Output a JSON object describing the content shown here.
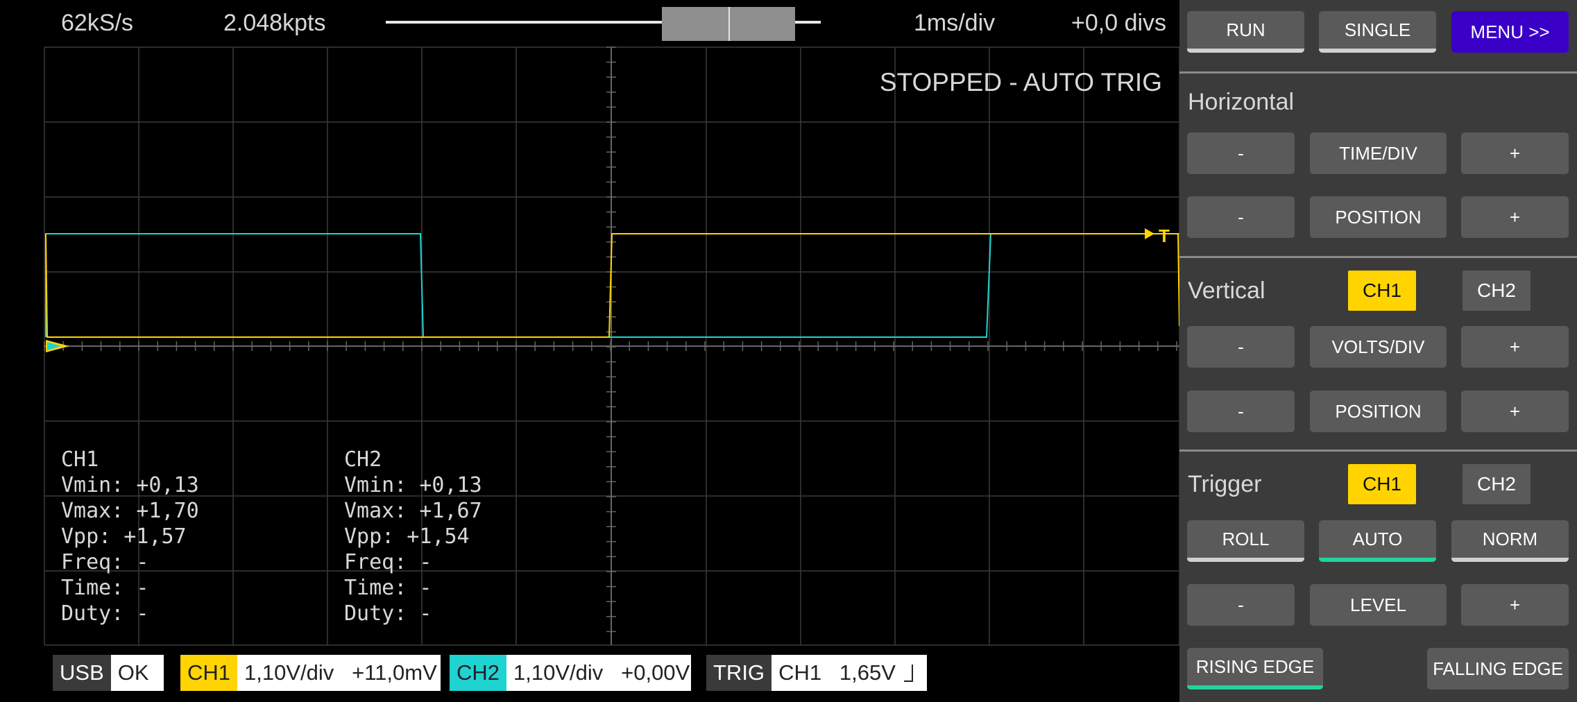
{
  "topbar": {
    "sample_rate": "62kS/s",
    "points": "2.048kpts",
    "timebase": "1ms/div",
    "offset": "+0,0 divs"
  },
  "status": "STOPPED - AUTO TRIG",
  "measurements": {
    "ch1": {
      "title": "CH1",
      "vmin": "Vmin: +0,13",
      "vmax": "Vmax: +1,70",
      "vpp": "Vpp: +1,57",
      "freq": "Freq: -",
      "time": "Time: -",
      "duty": "Duty: -"
    },
    "ch2": {
      "title": "CH2",
      "vmin": "Vmin: +0,13",
      "vmax": "Vmax: +1,67",
      "vpp": "Vpp: +1,54",
      "freq": "Freq: -",
      "time": "Time: -",
      "duty": "Duty: -"
    }
  },
  "bottom": {
    "usb_tag": "USB",
    "usb_val": "OK",
    "ch1_tag": "CH1",
    "ch1_val": "1,10V/div   +11,0mV",
    "ch2_tag": "CH2",
    "ch2_val": "1,10V/div   +0,00V",
    "trig_tag": "TRIG",
    "trig_val": "CH1   1,65V"
  },
  "colors": {
    "ch1": "#ffd400",
    "ch2": "#1fd3d3",
    "menu": "#3a00c8",
    "active": "#1fd3a0"
  },
  "panel": {
    "run": "RUN",
    "single": "SINGLE",
    "menu": "MENU >>",
    "horizontal": "Horizontal",
    "minus": "-",
    "plus": "+",
    "time_div": "TIME/DIV",
    "position": "POSITION",
    "vertical": "Vertical",
    "ch1": "CH1",
    "ch2": "CH2",
    "volts_div": "VOLTS/DIV",
    "trigger": "Trigger",
    "roll": "ROLL",
    "auto": "AUTO",
    "norm": "NORM",
    "level": "LEVEL",
    "rising": "RISING EDGE",
    "falling": "FALLING EDGE"
  }
}
